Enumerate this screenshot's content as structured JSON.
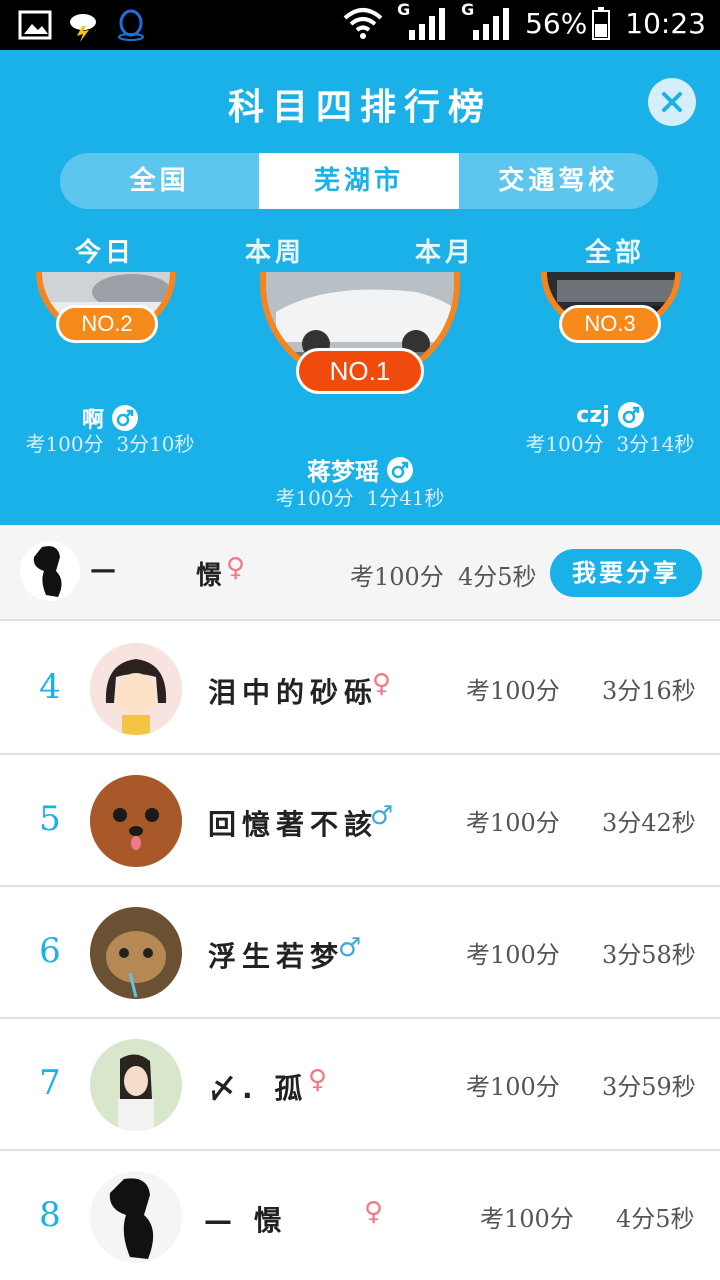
{
  "status_bar": {
    "battery": "56%",
    "time": "10:23",
    "signal_label": "G"
  },
  "header": {
    "title": "科目四排行榜",
    "close_icon": "close-icon",
    "segments": [
      "全国",
      "芜湖市",
      "交通驾校"
    ],
    "active_segment": 1,
    "periods": [
      "今日",
      "本周",
      "本月",
      "全部"
    ],
    "active_period": 0
  },
  "podium": {
    "first": {
      "badge": "NO.1",
      "name": "蒋梦瑶",
      "gender": "male",
      "score": "考100分",
      "time": "1分41秒"
    },
    "second": {
      "badge": "NO.2",
      "name": "啊",
      "gender": "male",
      "score": "考100分",
      "time": "3分10秒"
    },
    "third": {
      "badge": "NO.3",
      "name": "czj",
      "gender": "male",
      "score": "考100分",
      "time": "3分14秒"
    }
  },
  "my_rank": {
    "name_left": "—",
    "name_right": "憬",
    "gender": "female",
    "score": "考100分",
    "time": "4分5秒",
    "share_label": "我要分享"
  },
  "list": [
    {
      "rank": "4",
      "name": "泪中的砂砾",
      "gender_symbol": "♀",
      "gender": "female",
      "score": "考100分",
      "time": "3分16秒"
    },
    {
      "rank": "5",
      "name": "回憶著不該",
      "gender_symbol": "♂",
      "gender": "male",
      "score": "考100分",
      "time": "3分42秒"
    },
    {
      "rank": "6",
      "name": "浮生若梦",
      "gender_symbol": "♂",
      "gender": "male",
      "score": "考100分",
      "time": "3分58秒"
    },
    {
      "rank": "7",
      "name": "〆. 孤",
      "gender_symbol": "♀",
      "gender": "female",
      "score": "考100分",
      "time": "3分59秒"
    },
    {
      "rank": "8",
      "name": "—         憬",
      "gender_symbol": "♀",
      "gender": "female",
      "score": "考100分",
      "time": "4分5秒"
    }
  ],
  "colors": {
    "accent": "#1ab0e8",
    "badge_orange": "#f58a1a",
    "badge_red": "#f04a0d",
    "male": "#3fa9d8",
    "female": "#f07a84"
  }
}
